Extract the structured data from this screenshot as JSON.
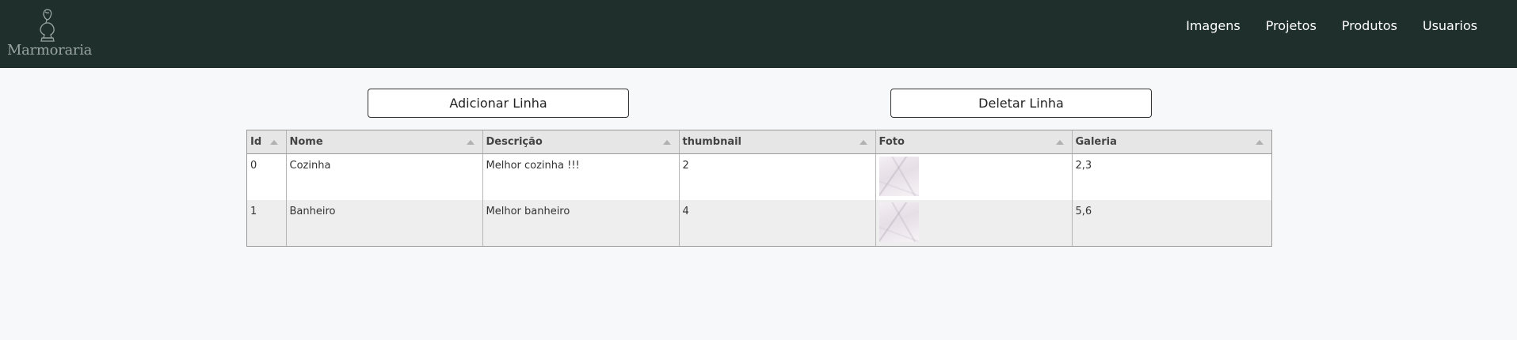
{
  "brand": {
    "name": "Marmoraria",
    "logo_icon": "bust-statue-icon"
  },
  "nav": {
    "items": [
      "Imagens",
      "Projetos",
      "Produtos",
      "Usuarios"
    ]
  },
  "actions": {
    "add_row": "Adicionar Linha",
    "delete_row": "Deletar Linha"
  },
  "table": {
    "columns": [
      "Id",
      "Nome",
      "Descrição",
      "thumbnail",
      "Foto",
      "Galeria"
    ],
    "rows": [
      {
        "id": "0",
        "nome": "Cozinha",
        "descricao": "Melhor cozinha !!!",
        "thumbnail": "2",
        "foto": "marble-thumbnail",
        "galeria": "2,3"
      },
      {
        "id": "1",
        "nome": "Banheiro",
        "descricao": "Melhor banheiro",
        "thumbnail": "4",
        "foto": "marble-thumbnail",
        "galeria": "5,6"
      }
    ]
  },
  "colors": {
    "navbar": "#1e2f2c",
    "background": "#f7f8fa",
    "header_bg": "#e6e6e6",
    "alt_row": "#efeeef"
  }
}
